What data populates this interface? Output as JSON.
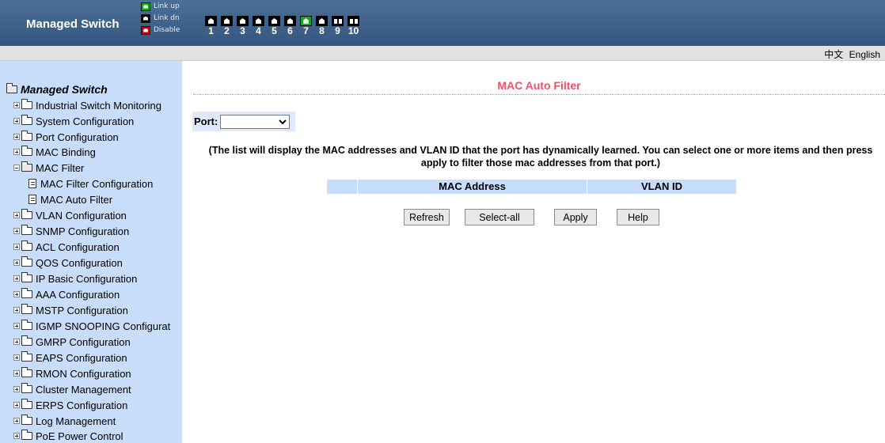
{
  "header": {
    "brand": "Managed Switch",
    "legend": [
      {
        "label": "Link up",
        "state": "up"
      },
      {
        "label": "Link dn",
        "state": "dn"
      },
      {
        "label": "Disable",
        "state": "dis"
      }
    ],
    "ports": [
      {
        "num": "1",
        "kind": "copper",
        "state": "black"
      },
      {
        "num": "2",
        "kind": "copper",
        "state": "black"
      },
      {
        "num": "3",
        "kind": "copper",
        "state": "black"
      },
      {
        "num": "4",
        "kind": "copper",
        "state": "black"
      },
      {
        "num": "5",
        "kind": "copper",
        "state": "black"
      },
      {
        "num": "6",
        "kind": "copper",
        "state": "black"
      },
      {
        "num": "7",
        "kind": "copper",
        "state": "green"
      },
      {
        "num": "8",
        "kind": "copper",
        "state": "black"
      },
      {
        "num": "9",
        "kind": "fiber",
        "state": "black"
      },
      {
        "num": "10",
        "kind": "fiber",
        "state": "black"
      }
    ]
  },
  "lang": {
    "chinese": "中文",
    "english": "English"
  },
  "sidebar": {
    "root": "Managed Switch",
    "items": [
      {
        "label": "Industrial Switch Monitoring",
        "type": "folder"
      },
      {
        "label": "System Configuration",
        "type": "folder"
      },
      {
        "label": "Port Configuration",
        "type": "folder"
      },
      {
        "label": "MAC Binding",
        "type": "folder"
      },
      {
        "label": "MAC Filter",
        "type": "folder-open"
      },
      {
        "label": "MAC Filter Configuration",
        "type": "page"
      },
      {
        "label": "MAC Auto Filter",
        "type": "page"
      },
      {
        "label": "VLAN Configuration",
        "type": "folder"
      },
      {
        "label": "SNMP Configuration",
        "type": "folder"
      },
      {
        "label": "ACL Configuration",
        "type": "folder"
      },
      {
        "label": "QOS Configuration",
        "type": "folder"
      },
      {
        "label": "IP Basic Configuration",
        "type": "folder"
      },
      {
        "label": "AAA Configuration",
        "type": "folder"
      },
      {
        "label": "MSTP Configuration",
        "type": "folder"
      },
      {
        "label": "IGMP SNOOPING Configurat",
        "type": "folder"
      },
      {
        "label": "GMRP Configuration",
        "type": "folder"
      },
      {
        "label": "EAPS Configuration",
        "type": "folder"
      },
      {
        "label": "RMON Configuration",
        "type": "folder"
      },
      {
        "label": "Cluster Management",
        "type": "folder"
      },
      {
        "label": "ERPS Configuration",
        "type": "folder"
      },
      {
        "label": "Log Management",
        "type": "folder"
      },
      {
        "label": "PoE Power Control",
        "type": "folder"
      }
    ]
  },
  "main": {
    "title": "MAC Auto Filter",
    "port_label": "Port:",
    "port_value": "",
    "description": "(The list will display the MAC addresses and VLAN ID that the port has dynamically learned. You can select one or more items and then press apply to filter those mac addresses from that port.)",
    "table": {
      "headers": [
        "",
        "MAC Address",
        "VLAN ID"
      ]
    },
    "buttons": {
      "refresh": "Refresh",
      "select_all": "Select-all",
      "apply": "Apply",
      "help": "Help"
    }
  },
  "colors": {
    "header_bg": "#3f628b",
    "sidebar_bg": "#c8ddf9",
    "title": "#f0506e",
    "link_up": "#10a820",
    "disable": "#cc0000"
  }
}
